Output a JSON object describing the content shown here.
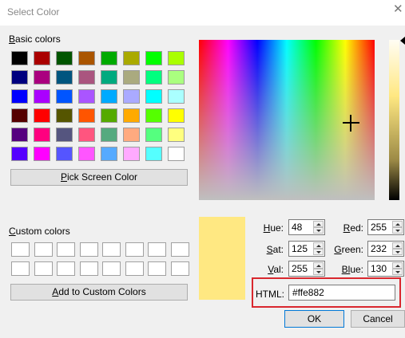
{
  "window": {
    "title": "Select Color",
    "close_icon": "close-icon"
  },
  "basic_colors": {
    "label_prefix": "B",
    "label_rest": "asic colors",
    "rows": [
      [
        "#000000",
        "#aa0000",
        "#005500",
        "#aa5500",
        "#00aa00",
        "#aaaa00",
        "#00ff00",
        "#aaff00"
      ],
      [
        "#00007f",
        "#aa007f",
        "#00557f",
        "#aa557f",
        "#00aa7f",
        "#aaaa7f",
        "#00ff7f",
        "#aaff7f"
      ],
      [
        "#0000ff",
        "#aa00ff",
        "#0055ff",
        "#aa55ff",
        "#00aaff",
        "#aaaaff",
        "#00ffff",
        "#aaffff"
      ],
      [
        "#550000",
        "#ff0000",
        "#555500",
        "#ff5500",
        "#55aa00",
        "#ffaa00",
        "#55ff00",
        "#ffff00"
      ],
      [
        "#55007f",
        "#ff007f",
        "#55557f",
        "#ff557f",
        "#55aa7f",
        "#ffaa7f",
        "#55ff7f",
        "#ffff7f"
      ],
      [
        "#5500ff",
        "#ff00ff",
        "#5555ff",
        "#ff55ff",
        "#55aaff",
        "#ffaaff",
        "#55ffff",
        "#ffffff"
      ]
    ]
  },
  "pick_screen": {
    "underlined": "P",
    "rest": "ick Screen Color"
  },
  "custom_colors": {
    "label_prefix": "C",
    "label_rest": "ustom colors",
    "rows": [
      [
        "#ffffff",
        "#ffffff",
        "#ffffff",
        "#ffffff",
        "#ffffff",
        "#ffffff",
        "#ffffff",
        "#ffffff"
      ],
      [
        "#ffffff",
        "#ffffff",
        "#ffffff",
        "#ffffff",
        "#ffffff",
        "#ffffff",
        "#ffffff",
        "#ffffff"
      ]
    ]
  },
  "add_custom": {
    "underlined": "A",
    "rest": "dd to Custom Colors"
  },
  "current_color": "#ffe882",
  "fields": {
    "hue": {
      "u": "H",
      "rest": "ue:",
      "value": "48"
    },
    "sat": {
      "u": "S",
      "rest": "at:",
      "value": "125"
    },
    "val": {
      "u": "V",
      "rest": "al:",
      "value": "255"
    },
    "red": {
      "u": "R",
      "rest": "ed:",
      "value": "255"
    },
    "green": {
      "u": "G",
      "rest": "reen:",
      "value": "232"
    },
    "blue": {
      "u": "Bl",
      "rest": "ue:",
      "value": "130"
    }
  },
  "html": {
    "label": "HTML:",
    "value": "#ffe882"
  },
  "buttons": {
    "ok": "OK",
    "cancel": "Cancel"
  }
}
